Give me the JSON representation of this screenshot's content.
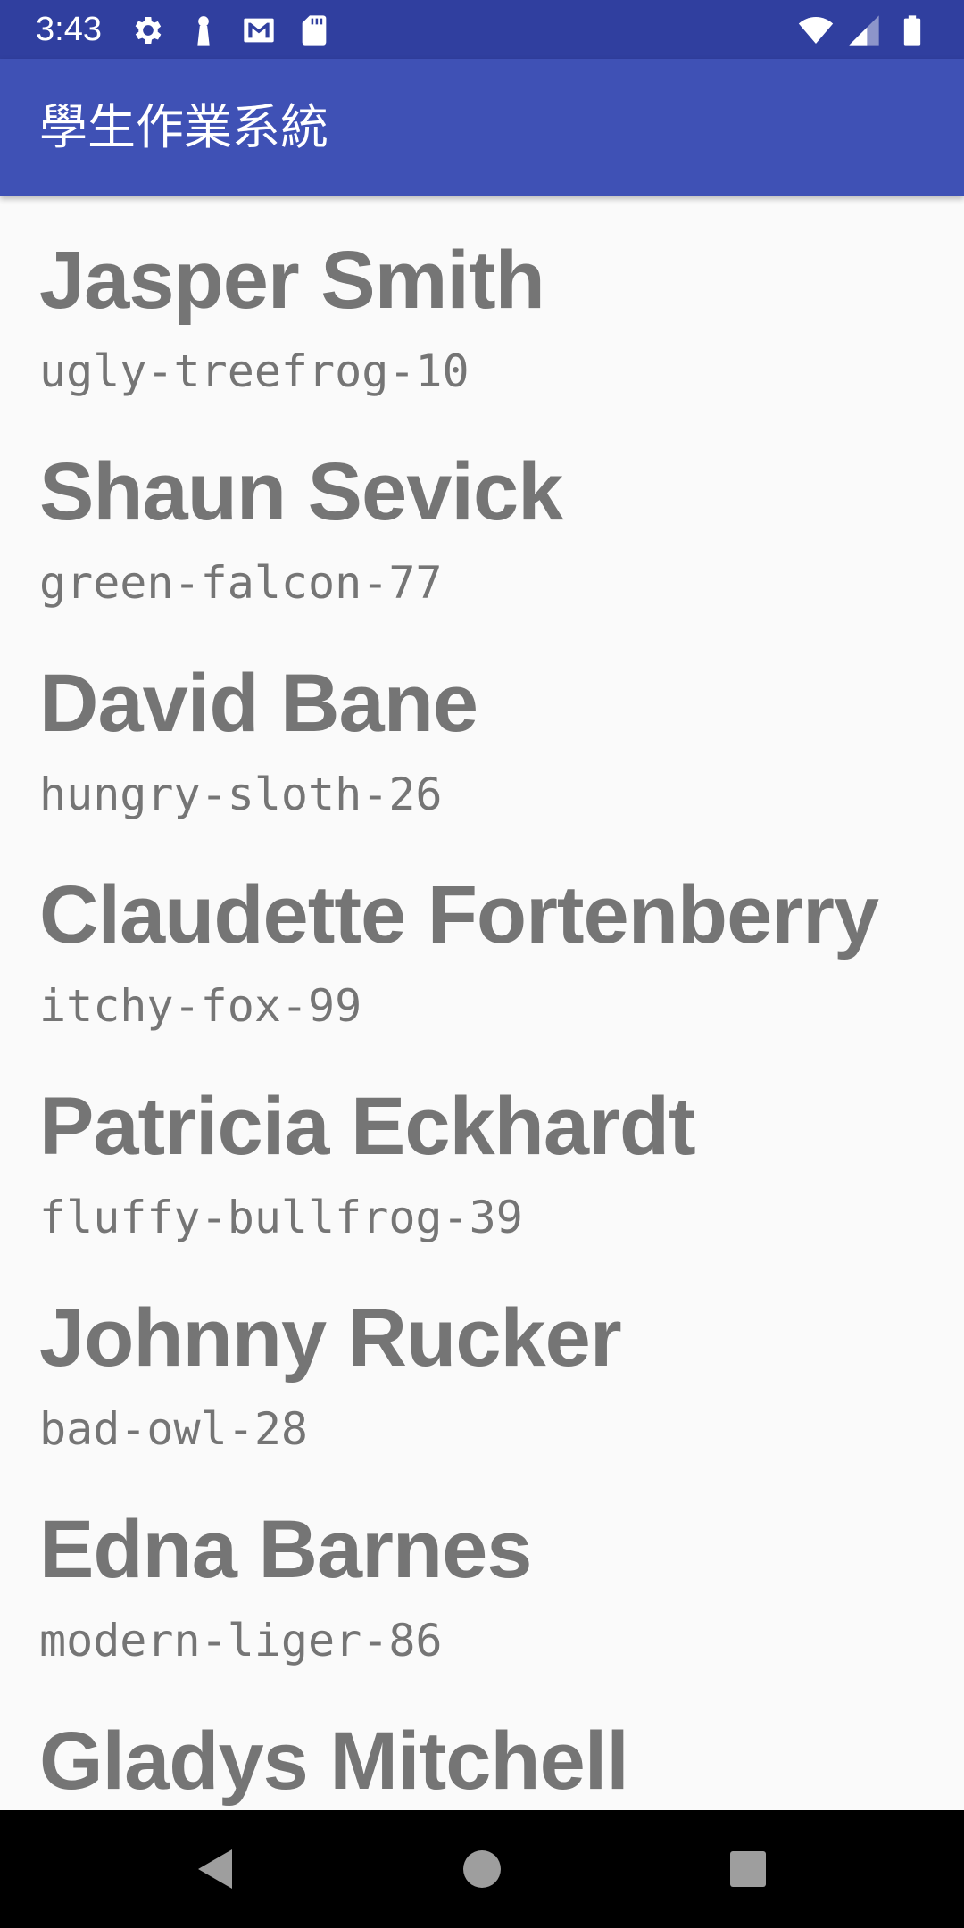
{
  "status_bar": {
    "time": "3:43",
    "left_icons": [
      "settings-icon",
      "keyhole-icon",
      "gmail-icon",
      "sd-card-icon"
    ],
    "right_icons": [
      "wifi-icon",
      "cellular-signal-icon",
      "battery-icon"
    ]
  },
  "app_bar": {
    "title": "學生作業系統"
  },
  "students": [
    {
      "name": "Jasper Smith",
      "id": "ugly-treefrog-10"
    },
    {
      "name": "Shaun Sevick",
      "id": "green-falcon-77"
    },
    {
      "name": "David Bane",
      "id": "hungry-sloth-26"
    },
    {
      "name": "Claudette Fortenberry",
      "id": "itchy-fox-99"
    },
    {
      "name": "Patricia Eckhardt",
      "id": "fluffy-bullfrog-39"
    },
    {
      "name": "Johnny Rucker",
      "id": "bad-owl-28"
    },
    {
      "name": "Edna Barnes",
      "id": "modern-liger-86"
    },
    {
      "name": "Gladys Mitchell",
      "id": ""
    }
  ],
  "nav_bar": {
    "buttons": [
      "back-icon",
      "home-icon",
      "recents-icon"
    ]
  },
  "colors": {
    "status_bar": "#303f9f",
    "app_bar": "#3f51b5",
    "text_gray": "#757575",
    "background": "#fafafa"
  }
}
